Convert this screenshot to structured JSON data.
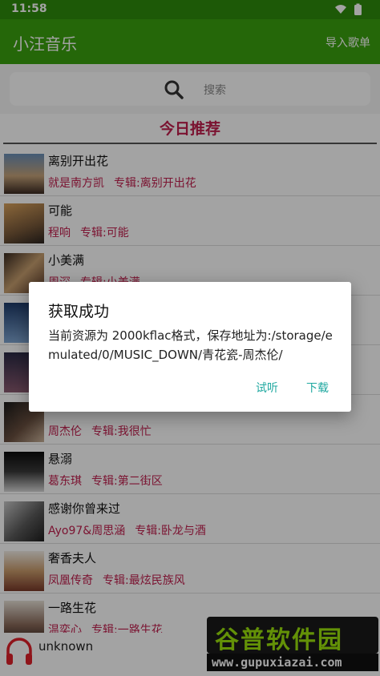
{
  "status_bar": {
    "time": "11:58"
  },
  "app_bar": {
    "title": "小汪音乐",
    "import_label": "导入歌单"
  },
  "search": {
    "placeholder": "搜索"
  },
  "section_title": "今日推荐",
  "songs": [
    {
      "title": "离别开出花",
      "artist": "就是南方凯",
      "album": "专辑:离别开出花"
    },
    {
      "title": "可能",
      "artist": "程响",
      "album": "专辑:可能"
    },
    {
      "title": "小美满",
      "artist": "周深",
      "album": "专辑:小美满"
    },
    {
      "title": "",
      "artist": "",
      "album": ""
    },
    {
      "title": "",
      "artist": "",
      "album": ""
    },
    {
      "title": "",
      "artist": "周杰伦",
      "album": "专辑:我很忙"
    },
    {
      "title": "悬溺",
      "artist": "葛东琪",
      "album": "专辑:第二街区"
    },
    {
      "title": "感谢你曾来过",
      "artist": "Ayo97&周思涵",
      "album": "专辑:卧龙与酒"
    },
    {
      "title": "奢香夫人",
      "artist": "凤凰传奇",
      "album": "专辑:最炫民族风"
    },
    {
      "title": "一路生花",
      "artist": "温奕心",
      "album": "专辑:一路生花"
    }
  ],
  "player": {
    "title": "unknown"
  },
  "dialog": {
    "title": "获取成功",
    "message": "当前资源为 2000kflac格式，保存地址为:/storage/emulated/0/MUSIC_DOWN/青花瓷-周杰伦/",
    "listen_button": "试听",
    "download_button": "下载"
  },
  "watermark": {
    "brand": "谷普软件园",
    "url": "www.gupuxiazai.com"
  },
  "colors": {
    "app_bar": "#3aa20f",
    "status_bar": "#2e8b0c",
    "accent": "#c01f4e",
    "dialog_button": "#1fa8a0"
  }
}
